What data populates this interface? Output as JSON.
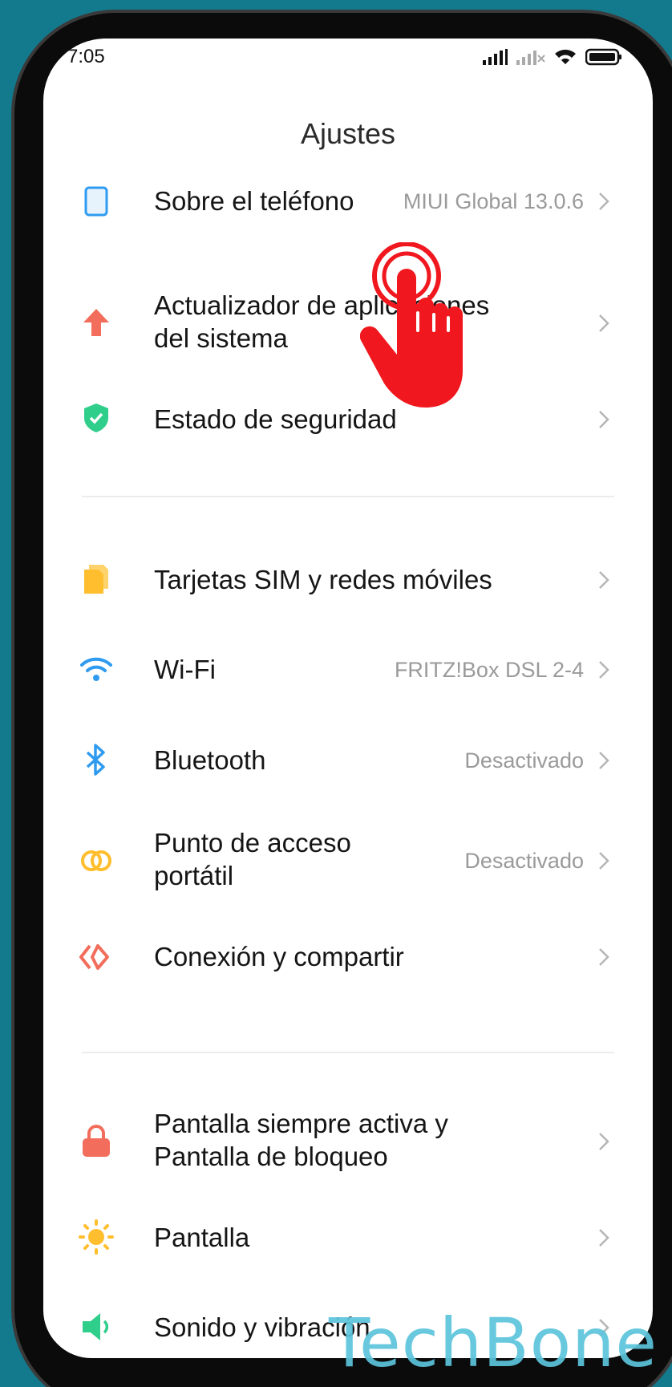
{
  "status_bar": {
    "time": "7:05"
  },
  "page": {
    "title": "Ajustes"
  },
  "rows": [
    {
      "label": "Sobre el teléfono",
      "value": "MIUI Global 13.0.6"
    },
    {
      "label": "Actualizador de aplicaciones",
      "label2": "del sistema",
      "value": ""
    },
    {
      "label": "Estado de seguridad",
      "value": ""
    },
    {
      "label": "Tarjetas SIM y redes móviles",
      "value": ""
    },
    {
      "label": "Wi-Fi",
      "value": "FRITZ!Box DSL 2-4"
    },
    {
      "label": "Bluetooth",
      "value": "Desactivado"
    },
    {
      "label": "Punto de acceso",
      "label2": "portátil",
      "value": "Desactivado"
    },
    {
      "label": "Conexión y compartir",
      "value": ""
    },
    {
      "label": "Pantalla siempre activa y",
      "label2": "Pantalla de bloqueo",
      "value": ""
    },
    {
      "label": "Pantalla",
      "value": ""
    },
    {
      "label": "Sonido y vibración",
      "value": ""
    }
  ],
  "icons": {
    "about": "phone-icon",
    "update": "arrow-up-icon",
    "security": "shield-check-icon",
    "sim": "sim-card-icon",
    "wifi": "wifi-icon",
    "bluetooth": "bluetooth-icon",
    "hotspot": "hotspot-icon",
    "connection": "connection-share-icon",
    "lock": "lock-icon",
    "display": "sun-icon",
    "sound": "speaker-icon"
  },
  "colors": {
    "background": "#137a8e",
    "accent_blue": "#2f9bf0",
    "accent_red": "#f26d5b",
    "accent_green": "#2fce8a",
    "accent_yellow": "#ffbe2e",
    "hand": "#f0181e",
    "watermark": "#5cc4dc"
  },
  "watermark": "TechBone"
}
